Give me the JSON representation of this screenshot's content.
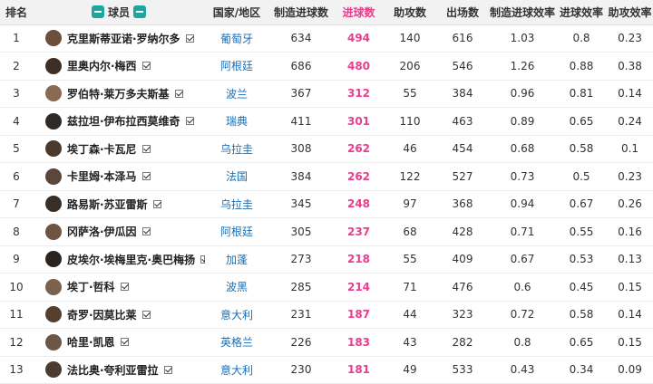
{
  "headers": {
    "rank": "排名",
    "player": "球员",
    "country": "国家/地区",
    "created_goals": "制造进球数",
    "goals": "进球数",
    "assists": "助攻数",
    "appearances": "出场数",
    "created_efficiency": "制造进球效率",
    "goal_efficiency": "进球效率",
    "assist_efficiency": "助攻效率"
  },
  "rows": [
    {
      "rank": "1",
      "name": "克里斯蒂亚诺·罗纳尔多",
      "country": "葡萄牙",
      "created": "634",
      "goals": "494",
      "assists": "140",
      "apps": "616",
      "c_eff": "1.03",
      "g_eff": "0.8",
      "a_eff": "0.23"
    },
    {
      "rank": "2",
      "name": "里奥内尔·梅西",
      "country": "阿根廷",
      "created": "686",
      "goals": "480",
      "assists": "206",
      "apps": "546",
      "c_eff": "1.26",
      "g_eff": "0.88",
      "a_eff": "0.38"
    },
    {
      "rank": "3",
      "name": "罗伯特·莱万多夫斯基",
      "country": "波兰",
      "created": "367",
      "goals": "312",
      "assists": "55",
      "apps": "384",
      "c_eff": "0.96",
      "g_eff": "0.81",
      "a_eff": "0.14"
    },
    {
      "rank": "4",
      "name": "兹拉坦·伊布拉西莫维奇",
      "country": "瑞典",
      "created": "411",
      "goals": "301",
      "assists": "110",
      "apps": "463",
      "c_eff": "0.89",
      "g_eff": "0.65",
      "a_eff": "0.24"
    },
    {
      "rank": "5",
      "name": "埃丁森·卡瓦尼",
      "country": "乌拉圭",
      "created": "308",
      "goals": "262",
      "assists": "46",
      "apps": "454",
      "c_eff": "0.68",
      "g_eff": "0.58",
      "a_eff": "0.1"
    },
    {
      "rank": "6",
      "name": "卡里姆·本泽马",
      "country": "法国",
      "created": "384",
      "goals": "262",
      "assists": "122",
      "apps": "527",
      "c_eff": "0.73",
      "g_eff": "0.5",
      "a_eff": "0.23"
    },
    {
      "rank": "7",
      "name": "路易斯·苏亚雷斯",
      "country": "乌拉圭",
      "created": "345",
      "goals": "248",
      "assists": "97",
      "apps": "368",
      "c_eff": "0.94",
      "g_eff": "0.67",
      "a_eff": "0.26"
    },
    {
      "rank": "8",
      "name": "冈萨洛·伊瓜因",
      "country": "阿根廷",
      "created": "305",
      "goals": "237",
      "assists": "68",
      "apps": "428",
      "c_eff": "0.71",
      "g_eff": "0.55",
      "a_eff": "0.16"
    },
    {
      "rank": "9",
      "name": "皮埃尔·埃梅里克·奥巴梅扬",
      "country": "加蓬",
      "created": "273",
      "goals": "218",
      "assists": "55",
      "apps": "409",
      "c_eff": "0.67",
      "g_eff": "0.53",
      "a_eff": "0.13"
    },
    {
      "rank": "10",
      "name": "埃丁·哲科",
      "country": "波黑",
      "created": "285",
      "goals": "214",
      "assists": "71",
      "apps": "476",
      "c_eff": "0.6",
      "g_eff": "0.45",
      "a_eff": "0.15"
    },
    {
      "rank": "11",
      "name": "奇罗·因莫比莱",
      "country": "意大利",
      "created": "231",
      "goals": "187",
      "assists": "44",
      "apps": "323",
      "c_eff": "0.72",
      "g_eff": "0.58",
      "a_eff": "0.14"
    },
    {
      "rank": "12",
      "name": "哈里·凯恩",
      "country": "英格兰",
      "created": "226",
      "goals": "183",
      "assists": "43",
      "apps": "282",
      "c_eff": "0.8",
      "g_eff": "0.65",
      "a_eff": "0.15"
    },
    {
      "rank": "13",
      "name": "法比奥·夸利亚雷拉",
      "country": "意大利",
      "created": "230",
      "goals": "181",
      "assists": "49",
      "apps": "533",
      "c_eff": "0.43",
      "g_eff": "0.34",
      "a_eff": "0.09"
    }
  ],
  "colors": {
    "goals_accent": "#e83e8c",
    "country_link": "#1a6fb5",
    "header_bg": "#f2f2f2",
    "logo_teal": "#1fa5a0"
  },
  "icons": {
    "header_left": "team-logo-icon",
    "header_right": "team-logo-icon",
    "avatar": "player-avatar",
    "checkbox": "checked-checkbox-icon"
  }
}
